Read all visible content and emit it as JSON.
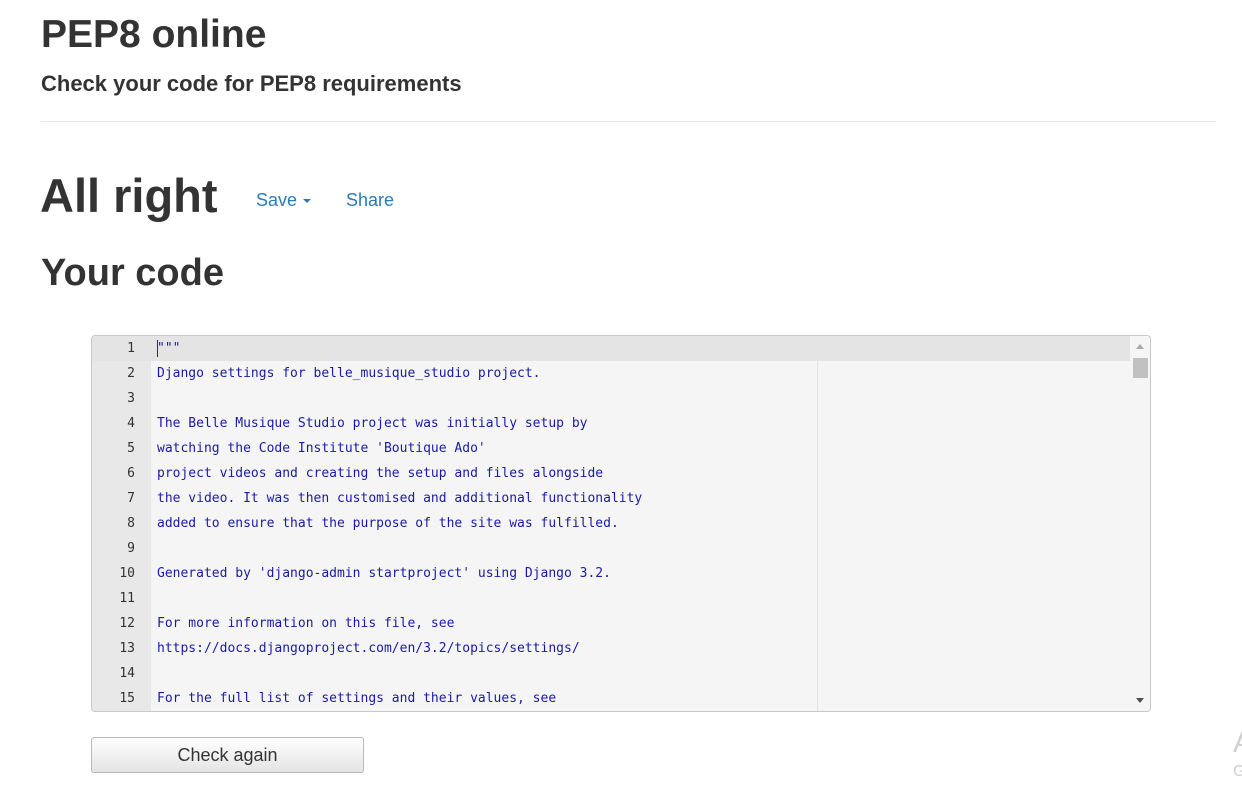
{
  "header": {
    "title": "PEP8 online",
    "subtitle": "Check your code for PEP8 requirements"
  },
  "result": {
    "title": "All right",
    "save_label": "Save",
    "share_label": "Share"
  },
  "code_section": {
    "title": "Your code"
  },
  "editor": {
    "lines": [
      {
        "number": "1",
        "text": "\"\"\""
      },
      {
        "number": "2",
        "text": "Django settings for belle_musique_studio project."
      },
      {
        "number": "3",
        "text": ""
      },
      {
        "number": "4",
        "text": "The Belle Musique Studio project was initially setup by"
      },
      {
        "number": "5",
        "text": "watching the Code Institute 'Boutique Ado'"
      },
      {
        "number": "6",
        "text": "project videos and creating the setup and files alongside"
      },
      {
        "number": "7",
        "text": "the video. It was then customised and additional functionality"
      },
      {
        "number": "8",
        "text": "added to ensure that the purpose of the site was fulfilled."
      },
      {
        "number": "9",
        "text": ""
      },
      {
        "number": "10",
        "text": "Generated by 'django-admin startproject' using Django 3.2."
      },
      {
        "number": "11",
        "text": ""
      },
      {
        "number": "12",
        "text": "For more information on this file, see"
      },
      {
        "number": "13",
        "text": "https://docs.djangoproject.com/en/3.2/topics/settings/"
      },
      {
        "number": "14",
        "text": ""
      },
      {
        "number": "15",
        "text": "For the full list of settings and their values, see"
      }
    ]
  },
  "actions": {
    "check_again_label": "Check again"
  },
  "corner_partial": {
    "glyph_a": "A",
    "glyph_g": "G"
  }
}
